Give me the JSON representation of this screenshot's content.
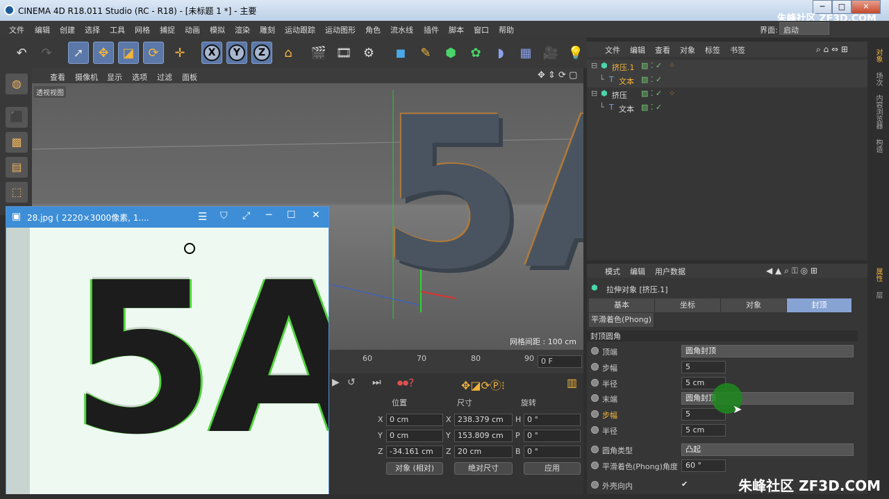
{
  "window": {
    "title": "CINEMA 4D R18.011 Studio (RC - R18) - [未标题 1 *] - 主要",
    "minimize": "─",
    "maximize": "□",
    "close": "✕"
  },
  "watermark_top": "朱峰社区 ZF3D.COM",
  "watermark_bottom": "朱峰社区 ZF3D.COM",
  "menu": [
    "文件",
    "编辑",
    "创建",
    "选择",
    "工具",
    "网格",
    "捕捉",
    "动画",
    "模拟",
    "渲染",
    "雕刻",
    "运动跟踪",
    "运动图形",
    "角色",
    "流水线",
    "插件",
    "脚本",
    "窗口",
    "帮助"
  ],
  "layout": {
    "label": "界面:",
    "value": "启动"
  },
  "viewport": {
    "menu": [
      "查看",
      "摄像机",
      "显示",
      "选项",
      "过滤",
      "面板"
    ],
    "name": "透视视图",
    "grid_spacing": "网格间距 : 100 cm",
    "model_text": "5A"
  },
  "timeline": {
    "ticks": [
      "60",
      "70",
      "80",
      "90"
    ],
    "frame": "0 F"
  },
  "coords": {
    "headers": [
      "位置",
      "尺寸",
      "旋转"
    ],
    "rows": [
      {
        "axis": "X",
        "pos": "0 cm",
        "size_axis": "X",
        "size": "238.379 cm",
        "rot_axis": "H",
        "rot": "0 °"
      },
      {
        "axis": "Y",
        "pos": "0 cm",
        "size_axis": "Y",
        "size": "153.809 cm",
        "rot_axis": "P",
        "rot": "0 °"
      },
      {
        "axis": "Z",
        "pos": "-34.161 cm",
        "size_axis": "Z",
        "size": "20 cm",
        "rot_axis": "B",
        "rot": "0 °"
      }
    ],
    "mode": "对象 (相对)",
    "size_mode": "绝对尺寸",
    "apply": "应用"
  },
  "objects": {
    "menu": [
      "文件",
      "编辑",
      "查看",
      "对象",
      "标签",
      "书签"
    ],
    "items": [
      {
        "name": "挤压.1",
        "level": 0,
        "selected": true
      },
      {
        "name": "文本",
        "level": 1,
        "selected": true
      },
      {
        "name": "挤压",
        "level": 0,
        "selected": false
      },
      {
        "name": "文本",
        "level": 1,
        "selected": false
      }
    ]
  },
  "side_tabs": [
    "对象",
    "场次",
    "内容浏览器",
    "构造"
  ],
  "side_tabs2": [
    "属性",
    "层"
  ],
  "attributes": {
    "menu": [
      "模式",
      "编辑",
      "用户数据"
    ],
    "object_title": "拉伸对象 [挤压.1]",
    "tabs": [
      "基本",
      "坐标",
      "对象",
      "封顶"
    ],
    "active_tab": "封顶",
    "subtab": "平滑着色(Phong)",
    "section": "封顶圆角",
    "rows": [
      {
        "label": "顶端",
        "type": "dropdown",
        "value": "圆角封顶"
      },
      {
        "label": "步幅",
        "type": "field",
        "value": "5"
      },
      {
        "label": "半径",
        "type": "field",
        "value": "5 cm"
      },
      {
        "label": "末端",
        "type": "dropdown",
        "value": "圆角封顶"
      },
      {
        "label": "步幅",
        "type": "field",
        "value": "5"
      },
      {
        "label": "半径",
        "type": "field",
        "value": "5 cm"
      },
      {
        "label": "圆角类型",
        "type": "dropdown",
        "value": "凸起"
      },
      {
        "label": "平滑着色(Phong)角度",
        "type": "field",
        "value": "60 °"
      },
      {
        "label": "外壳向内",
        "type": "check",
        "value": "✔"
      }
    ]
  },
  "image_viewer": {
    "title": "28.jpg ( 2220×3000像素, 1....",
    "menu_icon": "☰",
    "text": "5A"
  },
  "colors": {
    "accent": "#3d8ed6",
    "selected_tab": "#87a3d4",
    "glow": "#4fd43a"
  }
}
